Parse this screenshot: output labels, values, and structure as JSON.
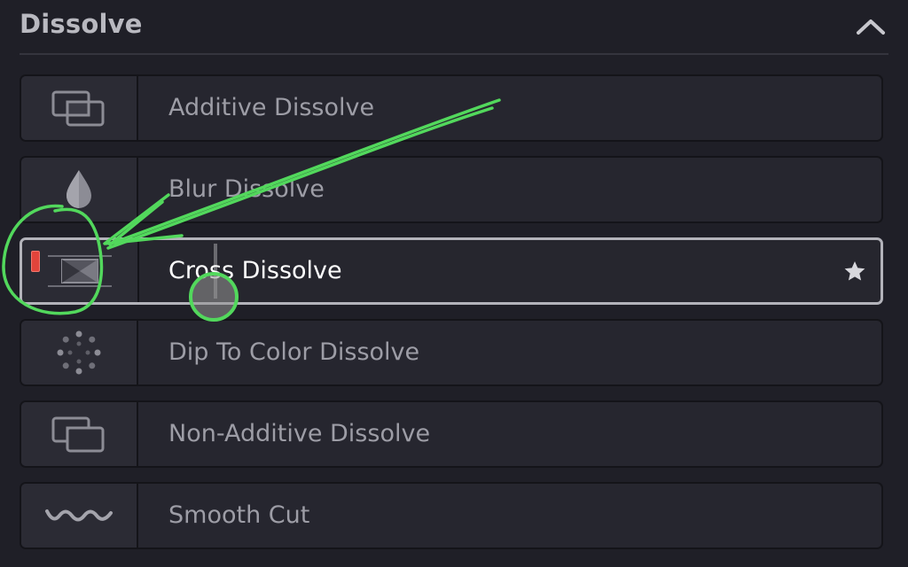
{
  "header": {
    "title": "Dissolve",
    "collapse_icon": "chevron-up-icon"
  },
  "transitions": [
    {
      "label": "Additive Dissolve",
      "icon": "overlapping-rectangles-icon",
      "selected": false
    },
    {
      "label": "Blur Dissolve",
      "icon": "droplet-icon",
      "selected": false
    },
    {
      "label": "Cross Dissolve",
      "icon": "cross-dissolve-icon",
      "selected": true,
      "favorite_icon": "star-icon"
    },
    {
      "label": "Dip To Color Dissolve",
      "icon": "dotted-circle-icon",
      "selected": false
    },
    {
      "label": "Non-Additive Dissolve",
      "icon": "overlapping-rectangles-icon",
      "selected": false
    },
    {
      "label": "Smooth Cut",
      "icon": "wave-icon",
      "selected": false
    }
  ],
  "colors": {
    "background": "#1f1f27",
    "row_background": "#26262f",
    "selected_border": "#b3b3ba",
    "annotation_green": "#52d85c",
    "marker_red": "#e1443b"
  }
}
